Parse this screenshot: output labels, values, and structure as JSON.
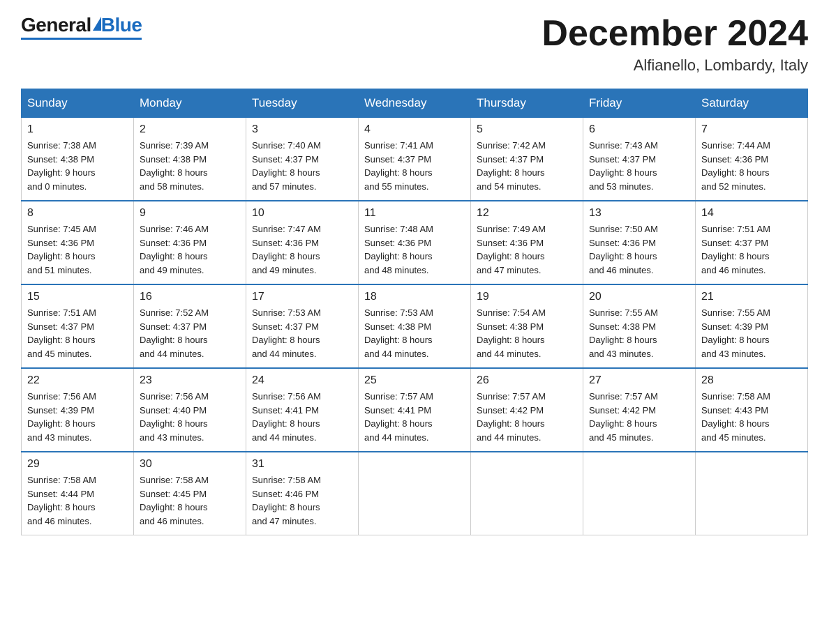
{
  "header": {
    "logo_general": "General",
    "logo_blue": "Blue",
    "month_title": "December 2024",
    "location": "Alfianello, Lombardy, Italy"
  },
  "days_of_week": [
    "Sunday",
    "Monday",
    "Tuesday",
    "Wednesday",
    "Thursday",
    "Friday",
    "Saturday"
  ],
  "weeks": [
    [
      {
        "day": "1",
        "sunrise": "7:38 AM",
        "sunset": "4:38 PM",
        "daylight": "9 hours and 0 minutes."
      },
      {
        "day": "2",
        "sunrise": "7:39 AM",
        "sunset": "4:38 PM",
        "daylight": "8 hours and 58 minutes."
      },
      {
        "day": "3",
        "sunrise": "7:40 AM",
        "sunset": "4:37 PM",
        "daylight": "8 hours and 57 minutes."
      },
      {
        "day": "4",
        "sunrise": "7:41 AM",
        "sunset": "4:37 PM",
        "daylight": "8 hours and 55 minutes."
      },
      {
        "day": "5",
        "sunrise": "7:42 AM",
        "sunset": "4:37 PM",
        "daylight": "8 hours and 54 minutes."
      },
      {
        "day": "6",
        "sunrise": "7:43 AM",
        "sunset": "4:37 PM",
        "daylight": "8 hours and 53 minutes."
      },
      {
        "day": "7",
        "sunrise": "7:44 AM",
        "sunset": "4:36 PM",
        "daylight": "8 hours and 52 minutes."
      }
    ],
    [
      {
        "day": "8",
        "sunrise": "7:45 AM",
        "sunset": "4:36 PM",
        "daylight": "8 hours and 51 minutes."
      },
      {
        "day": "9",
        "sunrise": "7:46 AM",
        "sunset": "4:36 PM",
        "daylight": "8 hours and 49 minutes."
      },
      {
        "day": "10",
        "sunrise": "7:47 AM",
        "sunset": "4:36 PM",
        "daylight": "8 hours and 49 minutes."
      },
      {
        "day": "11",
        "sunrise": "7:48 AM",
        "sunset": "4:36 PM",
        "daylight": "8 hours and 48 minutes."
      },
      {
        "day": "12",
        "sunrise": "7:49 AM",
        "sunset": "4:36 PM",
        "daylight": "8 hours and 47 minutes."
      },
      {
        "day": "13",
        "sunrise": "7:50 AM",
        "sunset": "4:36 PM",
        "daylight": "8 hours and 46 minutes."
      },
      {
        "day": "14",
        "sunrise": "7:51 AM",
        "sunset": "4:37 PM",
        "daylight": "8 hours and 46 minutes."
      }
    ],
    [
      {
        "day": "15",
        "sunrise": "7:51 AM",
        "sunset": "4:37 PM",
        "daylight": "8 hours and 45 minutes."
      },
      {
        "day": "16",
        "sunrise": "7:52 AM",
        "sunset": "4:37 PM",
        "daylight": "8 hours and 44 minutes."
      },
      {
        "day": "17",
        "sunrise": "7:53 AM",
        "sunset": "4:37 PM",
        "daylight": "8 hours and 44 minutes."
      },
      {
        "day": "18",
        "sunrise": "7:53 AM",
        "sunset": "4:38 PM",
        "daylight": "8 hours and 44 minutes."
      },
      {
        "day": "19",
        "sunrise": "7:54 AM",
        "sunset": "4:38 PM",
        "daylight": "8 hours and 44 minutes."
      },
      {
        "day": "20",
        "sunrise": "7:55 AM",
        "sunset": "4:38 PM",
        "daylight": "8 hours and 43 minutes."
      },
      {
        "day": "21",
        "sunrise": "7:55 AM",
        "sunset": "4:39 PM",
        "daylight": "8 hours and 43 minutes."
      }
    ],
    [
      {
        "day": "22",
        "sunrise": "7:56 AM",
        "sunset": "4:39 PM",
        "daylight": "8 hours and 43 minutes."
      },
      {
        "day": "23",
        "sunrise": "7:56 AM",
        "sunset": "4:40 PM",
        "daylight": "8 hours and 43 minutes."
      },
      {
        "day": "24",
        "sunrise": "7:56 AM",
        "sunset": "4:41 PM",
        "daylight": "8 hours and 44 minutes."
      },
      {
        "day": "25",
        "sunrise": "7:57 AM",
        "sunset": "4:41 PM",
        "daylight": "8 hours and 44 minutes."
      },
      {
        "day": "26",
        "sunrise": "7:57 AM",
        "sunset": "4:42 PM",
        "daylight": "8 hours and 44 minutes."
      },
      {
        "day": "27",
        "sunrise": "7:57 AM",
        "sunset": "4:42 PM",
        "daylight": "8 hours and 45 minutes."
      },
      {
        "day": "28",
        "sunrise": "7:58 AM",
        "sunset": "4:43 PM",
        "daylight": "8 hours and 45 minutes."
      }
    ],
    [
      {
        "day": "29",
        "sunrise": "7:58 AM",
        "sunset": "4:44 PM",
        "daylight": "8 hours and 46 minutes."
      },
      {
        "day": "30",
        "sunrise": "7:58 AM",
        "sunset": "4:45 PM",
        "daylight": "8 hours and 46 minutes."
      },
      {
        "day": "31",
        "sunrise": "7:58 AM",
        "sunset": "4:46 PM",
        "daylight": "8 hours and 47 minutes."
      },
      null,
      null,
      null,
      null
    ]
  ],
  "labels": {
    "sunrise": "Sunrise:",
    "sunset": "Sunset:",
    "daylight": "Daylight:"
  }
}
